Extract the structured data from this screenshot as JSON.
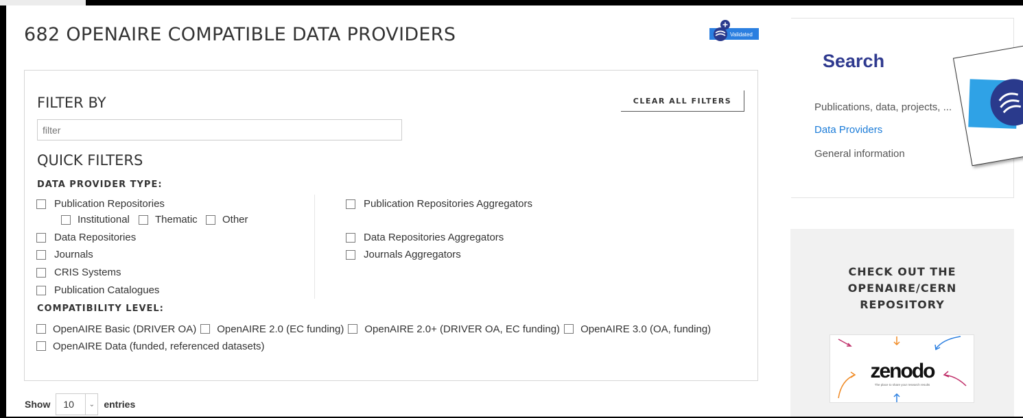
{
  "page_title": "682 OPENAIRE COMPATIBLE DATA PROVIDERS",
  "badge": {
    "label": "Validated",
    "color": "#2b7fe0"
  },
  "filter_panel": {
    "heading": "FILTER BY",
    "clear_label": "CLEAR ALL FILTERS",
    "input_placeholder": "filter",
    "quick_heading": "QUICK FILTERS",
    "type_heading": "DATA PROVIDER TYPE:",
    "types_left": [
      "Publication Repositories",
      "Data Repositories",
      "Journals",
      "CRIS Systems",
      "Publication Catalogues"
    ],
    "types_sub": [
      "Institutional",
      "Thematic",
      "Other"
    ],
    "types_right": [
      "Publication Repositories Aggregators",
      "Data Repositories Aggregators",
      "Journals Aggregators"
    ],
    "compat_heading": "COMPATIBILITY LEVEL:",
    "compat_levels": [
      "OpenAIRE Basic (DRIVER OA)",
      "OpenAIRE 2.0 (EC funding)",
      "OpenAIRE 2.0+ (DRIVER OA, EC funding)",
      "OpenAIRE 3.0 (OA, funding)",
      "OpenAIRE Data (funded, referenced datasets)"
    ]
  },
  "entries": {
    "show_label": "Show",
    "value": "10",
    "entries_label": "entries"
  },
  "sidebar": {
    "search_title": "Search",
    "items": [
      {
        "label": "Publications, data, projects, ...",
        "active": false
      },
      {
        "label": "Data Providers",
        "active": true
      },
      {
        "label": "General information",
        "active": false
      }
    ]
  },
  "promo": {
    "line1": "CHECK OUT THE",
    "line2": "OPENAIRE/CERN",
    "line3": "REPOSITORY",
    "logo_text": "zenodo",
    "tagline": "The place to share your research results"
  },
  "colors": {
    "accent": "#2f3a8f",
    "link": "#1a7bd8"
  }
}
